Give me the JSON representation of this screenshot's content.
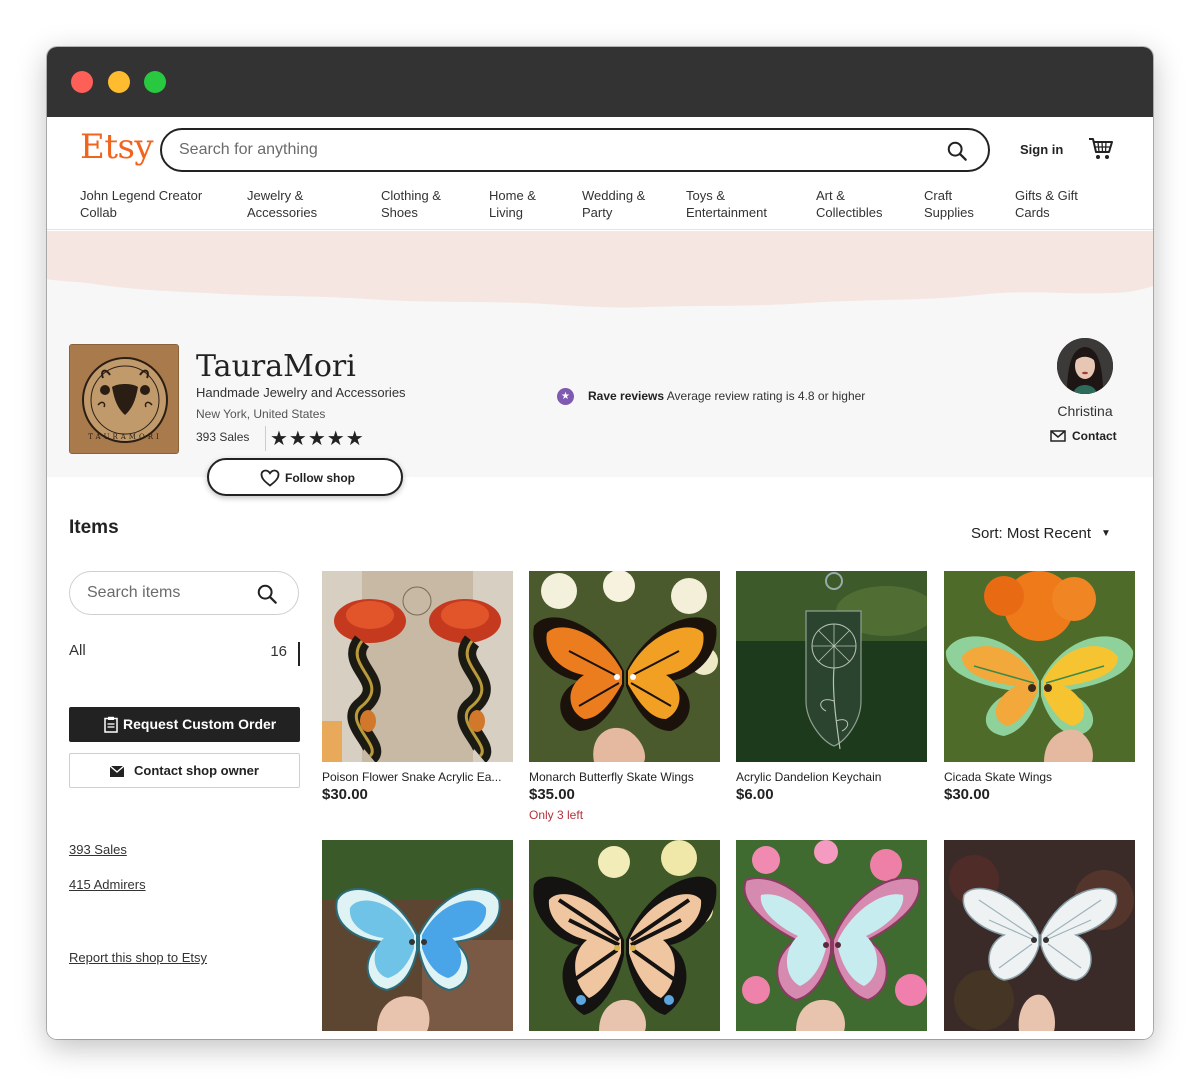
{
  "browser": {
    "controls": [
      "close",
      "minimize",
      "maximize"
    ]
  },
  "header": {
    "logo": "Etsy",
    "search_placeholder": "Search for anything",
    "signin": "Sign in",
    "categories": [
      "John Legend Creator\nCollab",
      "Jewelry &\nAccessories",
      "Clothing &\nShoes",
      "Home &\nLiving",
      "Wedding &\nParty",
      "Toys &\nEntertainment",
      "Art &\nCollectibles",
      "Craft\nSupplies",
      "Gifts & Gift\nCards"
    ]
  },
  "shop": {
    "name": "TauraMori",
    "tagline": "Handmade Jewelry and Accessories",
    "location": "New York, United States",
    "sales": "393 Sales",
    "stars": "★★★★★",
    "rating_stars": 5,
    "rave_label": "Rave reviews",
    "rave_text": "Average review rating is 4.8 or higher",
    "owner_name": "Christina",
    "contact": "Contact",
    "follow": "Follow shop",
    "logo_letters": "TAURAMORI"
  },
  "items_section": {
    "heading": "Items",
    "sort": "Sort: Most Recent",
    "search_placeholder": "Search items",
    "all_label": "All",
    "all_count": "16",
    "request_custom": "Request Custom Order",
    "contact_owner": "Contact shop owner",
    "sales_link": "393 Sales",
    "admirers_link": "415 Admirers",
    "report_link": "Report this shop to Etsy"
  },
  "listings": [
    {
      "title": "Poison Flower Snake Acrylic Ea...",
      "price": "$30.00",
      "stock": ""
    },
    {
      "title": "Monarch Butterfly Skate Wings",
      "price": "$35.00",
      "stock": "Only 3 left"
    },
    {
      "title": "Acrylic Dandelion Keychain",
      "price": "$6.00",
      "stock": ""
    },
    {
      "title": "Cicada Skate Wings",
      "price": "$30.00",
      "stock": ""
    },
    {
      "title": "",
      "price": "",
      "stock": ""
    },
    {
      "title": "",
      "price": "",
      "stock": ""
    },
    {
      "title": "",
      "price": "",
      "stock": ""
    },
    {
      "title": "",
      "price": "",
      "stock": ""
    }
  ],
  "colors": {
    "brand": "#f1641e",
    "dark": "#222222",
    "banner": "#f5e6e1",
    "shop_bg": "#f7f7f7",
    "stock": "#b3313a",
    "rave": "#7f5ab0"
  }
}
